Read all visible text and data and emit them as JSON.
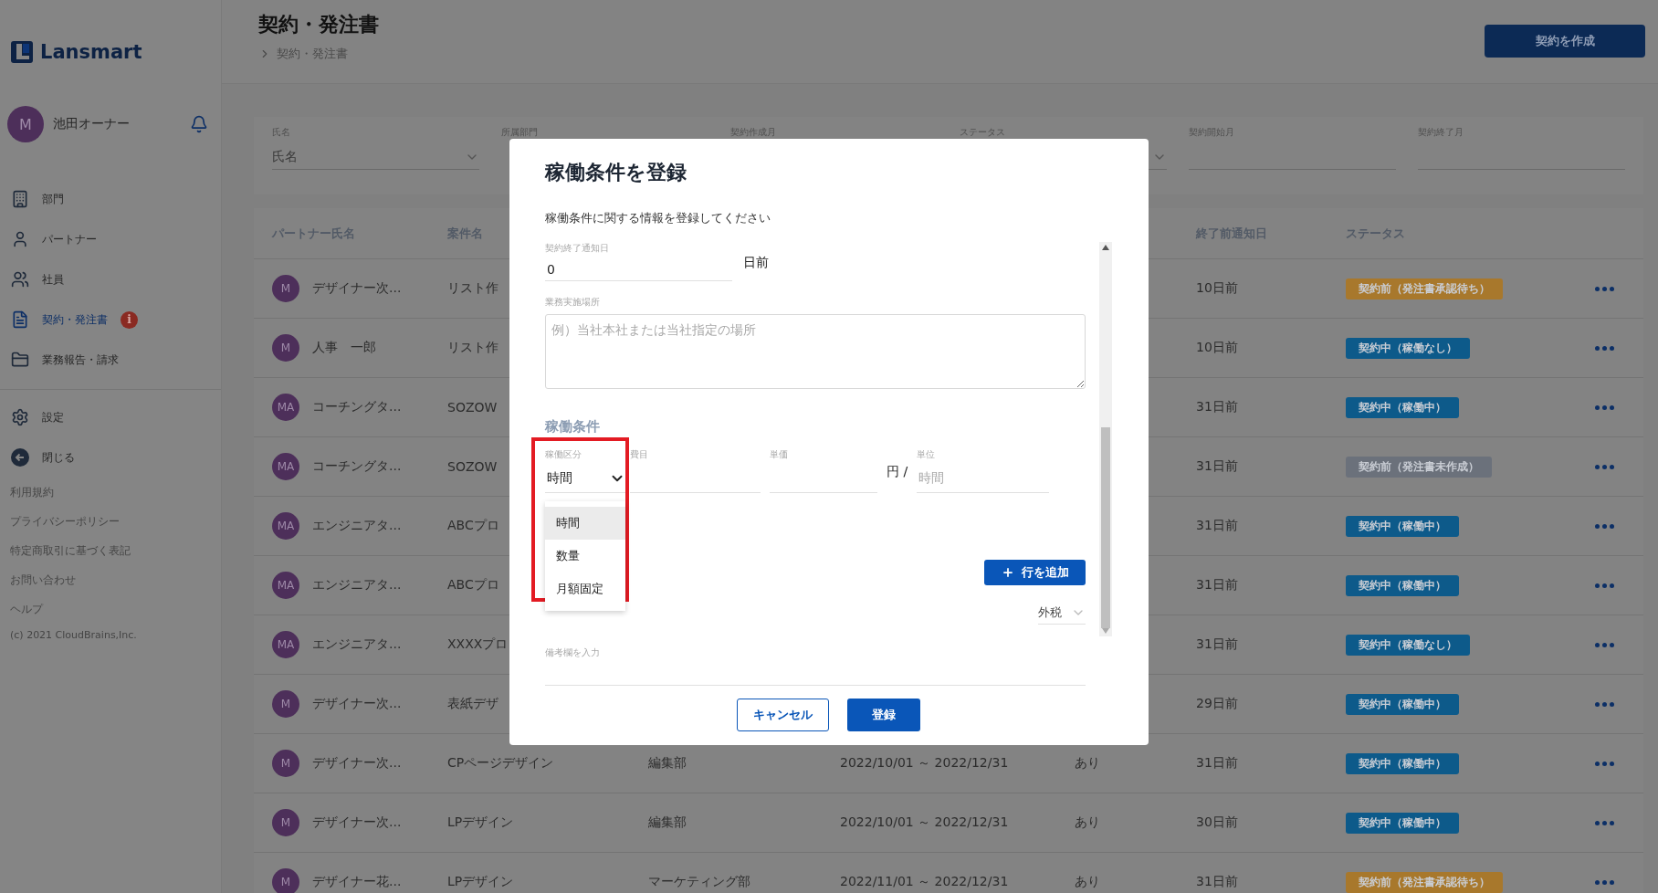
{
  "sidebar": {
    "logo": "Lansmart",
    "user": {
      "initial": "M",
      "name": "池田オーナー"
    },
    "nav": [
      {
        "label": "部門",
        "selected": false
      },
      {
        "label": "パートナー",
        "selected": false
      },
      {
        "label": "社員",
        "selected": false
      },
      {
        "label": "契約・発注書",
        "selected": true,
        "badge": "i"
      },
      {
        "label": "業務報告・請求",
        "selected": false
      }
    ],
    "actions": [
      {
        "label": "設定"
      },
      {
        "label": "閉じる"
      }
    ],
    "links": [
      "利用規約",
      "プライバシーポリシー",
      "特定商取引に基づく表記",
      "お問い合わせ",
      "ヘルプ"
    ],
    "copyright": "(c) 2021 CloudBrains,Inc."
  },
  "header": {
    "title": "契約・発注書",
    "breadcrumb": [
      "契約・発注書"
    ],
    "create_button": "契約を作成"
  },
  "filters": [
    {
      "label": "氏名",
      "kind": "select",
      "placeholder": "氏名"
    },
    {
      "label": "所属部門",
      "kind": "covered"
    },
    {
      "label": "契約作成月",
      "kind": "covered"
    },
    {
      "label": "ステータス",
      "kind": "select"
    },
    {
      "label": "契約開始月",
      "kind": "text"
    },
    {
      "label": "契約終了月",
      "kind": "text"
    }
  ],
  "table": {
    "columns": [
      {
        "label": "パートナー氏名"
      },
      {
        "label": "案件名"
      },
      {
        "label": "終了前通知日"
      },
      {
        "label": "ステータス"
      }
    ],
    "rows": [
      {
        "initials": "M",
        "name": "デザイナー次...",
        "project": "リスト作",
        "notice": "10日前",
        "status": {
          "label": "契約前（発注書承認待ち）",
          "color": "#a8782c"
        }
      },
      {
        "initials": "M",
        "name": "人事　一郎",
        "project": "リスト作",
        "notice": "10日前",
        "status": {
          "label": "契約中（稼働なし）",
          "color": "#0d5a8a"
        }
      },
      {
        "initials": "MA",
        "name": "コーチングタ...",
        "project": "SOZOW",
        "notice": "31日前",
        "status": {
          "label": "契約中（稼働中）",
          "color": "#0d5a8a"
        }
      },
      {
        "initials": "MA",
        "name": "コーチングタ...",
        "project": "SOZOW",
        "notice": "31日前",
        "status": {
          "label": "契約前（発注書未作成）",
          "color": "#6b717b"
        }
      },
      {
        "initials": "MA",
        "name": "エンジニアタ...",
        "project": "ABCプロ",
        "notice": "31日前",
        "status": {
          "label": "契約中（稼働中）",
          "color": "#0d5a8a"
        }
      },
      {
        "initials": "MA",
        "name": "エンジニアタ...",
        "project": "ABCプロ",
        "notice": "31日前",
        "status": {
          "label": "契約中（稼働中）",
          "color": "#0d5a8a"
        }
      },
      {
        "initials": "MA",
        "name": "エンジニアタ...",
        "project": "XXXXプロ",
        "notice": "31日前",
        "status": {
          "label": "契約中（稼働なし）",
          "color": "#0d5a8a"
        }
      },
      {
        "initials": "M",
        "name": "デザイナー次...",
        "project": "表紙デザ",
        "notice": "29日前",
        "status": {
          "label": "契約中（稼働中）",
          "color": "#0d5a8a"
        }
      },
      {
        "initials": "M",
        "name": "デザイナー次...",
        "project": "CPページデザイン",
        "column_3": "編集部",
        "column_4": "2022/10/01 ～ 2022/12/31",
        "column_5": "あり",
        "notice": "31日前",
        "status": {
          "label": "契約中（稼働中）",
          "color": "#0d5a8a"
        }
      },
      {
        "initials": "M",
        "name": "デザイナー次...",
        "project": "LPデザイン",
        "column_3": "編集部",
        "column_4": "2022/10/01 ～ 2022/12/31",
        "column_5": "あり",
        "notice": "30日前",
        "status": {
          "label": "契約中（稼働中）",
          "color": "#0d5a8a"
        }
      },
      {
        "initials": "M",
        "name": "デザイナー花...",
        "project": "LPデザイン",
        "column_3": "マーケティング部",
        "column_4": "2022/11/01 ～ 2022/12/31",
        "column_5": "あり",
        "notice": "31日前",
        "status": {
          "label": "契約前（発注書承認待ち）",
          "color": "#a8782c"
        }
      }
    ]
  },
  "modal": {
    "title": "稼働条件を登録",
    "description": "稼働条件に関する情報を登録してください",
    "notice_field": {
      "label": "契約終了通知日",
      "value": "0",
      "suffix": "日前"
    },
    "place_field": {
      "label": "業務実施場所",
      "placeholder": "例）当社本社または当社指定の場所"
    },
    "section_title": "稼働条件",
    "terms": {
      "select": {
        "label": "稼働区分",
        "value": "時間",
        "expanded": true,
        "highlighted": true,
        "options": [
          {
            "label": "時間",
            "selected": true
          },
          {
            "label": "数量",
            "selected": false
          },
          {
            "label": "月額固定",
            "selected": false
          }
        ]
      },
      "item_field": {
        "label": "費目"
      },
      "price_field": {
        "label": "単価"
      },
      "currency": "円 /",
      "unit_field": {
        "label": "単位",
        "placeholder": "時間"
      }
    },
    "add_row_button": "行を追加",
    "tax_select": "外税",
    "note_field": {
      "label": "備考欄を入力"
    },
    "cancel_button": "キャンセル",
    "submit_button": "登録"
  }
}
